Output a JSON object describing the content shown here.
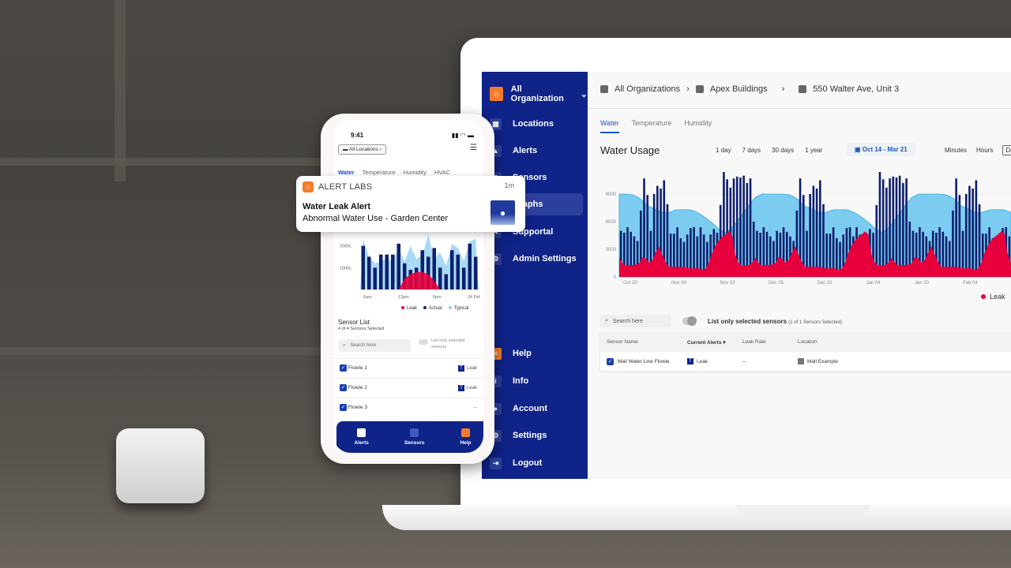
{
  "notification": {
    "app_name": "ALERT LABS",
    "time": "1m",
    "title": "Water Leak Alert",
    "body": "Abnormal Water Use - Garden Center",
    "icon": "water-drop-icon"
  },
  "desktop": {
    "sidebar": {
      "org_selector": "All Organization",
      "items": [
        {
          "label": "Locations",
          "icon": "building-icon"
        },
        {
          "label": "Alerts",
          "icon": "alert-icon"
        },
        {
          "label": "Sensors",
          "icon": "sensor-icon"
        },
        {
          "label": "Graphs",
          "icon": "graph-icon",
          "active": true
        },
        {
          "label": "Supportal",
          "icon": "support-icon"
        },
        {
          "label": "Admin Settings",
          "icon": "gear-icon"
        }
      ],
      "bottom_items": [
        {
          "label": "Help",
          "icon": "help-icon"
        },
        {
          "label": "Info",
          "icon": "info-icon"
        },
        {
          "label": "Account",
          "icon": "account-icon"
        },
        {
          "label": "Settings",
          "icon": "gear-icon"
        },
        {
          "label": "Logout",
          "icon": "logout-icon"
        }
      ]
    },
    "breadcrumb": [
      "All Organizations",
      "Apex Buildings",
      "550 Walter Ave, Unit 3"
    ],
    "tabs": [
      "Water",
      "Temperature",
      "Humidity"
    ],
    "active_tab": "Water",
    "title": "Water Usage",
    "ranges": [
      "1 day",
      "7 days",
      "30 days",
      "1 year"
    ],
    "date_range": "Oct 14 - Mar 21",
    "granularity": [
      "Minutes",
      "Hours",
      "Day"
    ],
    "legend": [
      "Leak"
    ],
    "search_placeholder": "Search here",
    "toggle_label": "List only selected sensors",
    "toggle_sub": "(1 of 1 Sensors Selected)",
    "table": {
      "headers": [
        "Sensor Name",
        "Current Alerts ▾",
        "Leak Rate",
        "Location"
      ],
      "rows": [
        {
          "name": "Mall Water Line Flowie",
          "alert": "Leak",
          "leak_rate": "--",
          "location": "Mall Example"
        }
      ]
    }
  },
  "mobile": {
    "time": "9:41",
    "location": "All Locations",
    "tabs": [
      "Water",
      "Temperature",
      "Humidity",
      "HVAC"
    ],
    "legend": [
      "Leak",
      "Actual",
      "Typical"
    ],
    "sensor_list_title": "Sensor List",
    "sensor_list_sub": "4 of 4 Sensors Selected",
    "search_placeholder": "Search here",
    "toggle_label": "List only selected sensors",
    "sensors": [
      {
        "name": "Flowie 1",
        "alert": "Leak"
      },
      {
        "name": "Flowie 2",
        "alert": "Leak"
      },
      {
        "name": "Flowie 3",
        "alert": "--"
      }
    ],
    "nav": [
      "Alerts",
      "Sensors",
      "Help"
    ]
  },
  "chart_data": [
    {
      "type": "bar",
      "title": "Water Usage",
      "categories_ticks": [
        "Oct 20",
        "Nov 04",
        "Nov 19",
        "Dec 05",
        "Dec 20",
        "Jan 04",
        "Jan 20",
        "Feb 04"
      ],
      "y_ticks": [
        0,
        3000,
        6000,
        9000
      ],
      "ylim": [
        0,
        12000
      ],
      "series": [
        {
          "name": "Actual",
          "color": "#0d1f6e",
          "pattern": [
            5000,
            4800,
            5400,
            4900,
            4400,
            3900,
            7200,
            10700,
            8900,
            5000,
            9000,
            9900,
            9600,
            10500,
            7900,
            4700,
            4700,
            5400,
            4200,
            3800,
            4600,
            5300,
            5400,
            4400,
            5400,
            4600,
            3800,
            4600,
            5200,
            4800,
            7800,
            11400,
            10600,
            9700,
            10700,
            10900,
            10800,
            11000,
            10200,
            10700,
            6000,
            5000,
            4800,
            5400,
            4900,
            4400,
            3900
          ]
        },
        {
          "name": "Typical",
          "color": "#5cc0ec",
          "pattern": [
            9000,
            9000,
            8900,
            8500,
            7700,
            7400,
            7000,
            7000,
            7300,
            7300,
            7300,
            7000,
            6500,
            5900,
            5200,
            4800,
            5500,
            6500,
            7600,
            8600,
            9000,
            9000
          ]
        },
        {
          "name": "Leak",
          "color": "#e8003d",
          "pattern": [
            2100,
            1200,
            1300,
            1300,
            1400,
            2400,
            1500,
            1900,
            3500,
            2200,
            1100,
            1100,
            1100,
            1100,
            1000,
            900,
            1000,
            800,
            900,
            2500,
            3700,
            4300,
            4700,
            5200,
            1900,
            1200,
            1300,
            1300
          ]
        }
      ],
      "legend": "bottom-right"
    },
    {
      "type": "bar",
      "y_ticks": [
        "1000L",
        "2000L"
      ],
      "x_ticks": [
        "6am",
        "12pm",
        "6pm",
        "24 Feb"
      ],
      "series": [
        {
          "name": "Actual",
          "values": [
            2000,
            1500,
            1000,
            1600,
            1600,
            1600,
            2100,
            1200,
            900,
            1000,
            1800,
            1500,
            1900,
            1000,
            700,
            1800,
            1600,
            1000,
            2100,
            1500
          ]
        },
        {
          "name": "Typical",
          "values": [
            2300,
            1500,
            1200,
            1300,
            1400,
            1300,
            1900,
            1300,
            2000,
            1400,
            1600,
            2500,
            1400,
            1700,
            1100,
            2100,
            1900,
            1300,
            2200,
            2300
          ]
        },
        {
          "name": "Leak",
          "values": [
            0,
            0,
            0,
            0,
            0,
            0,
            0,
            500,
            700,
            800,
            800,
            700,
            400,
            0,
            0,
            0,
            0,
            0,
            0,
            0
          ]
        }
      ],
      "legend": "bottom-right"
    }
  ]
}
